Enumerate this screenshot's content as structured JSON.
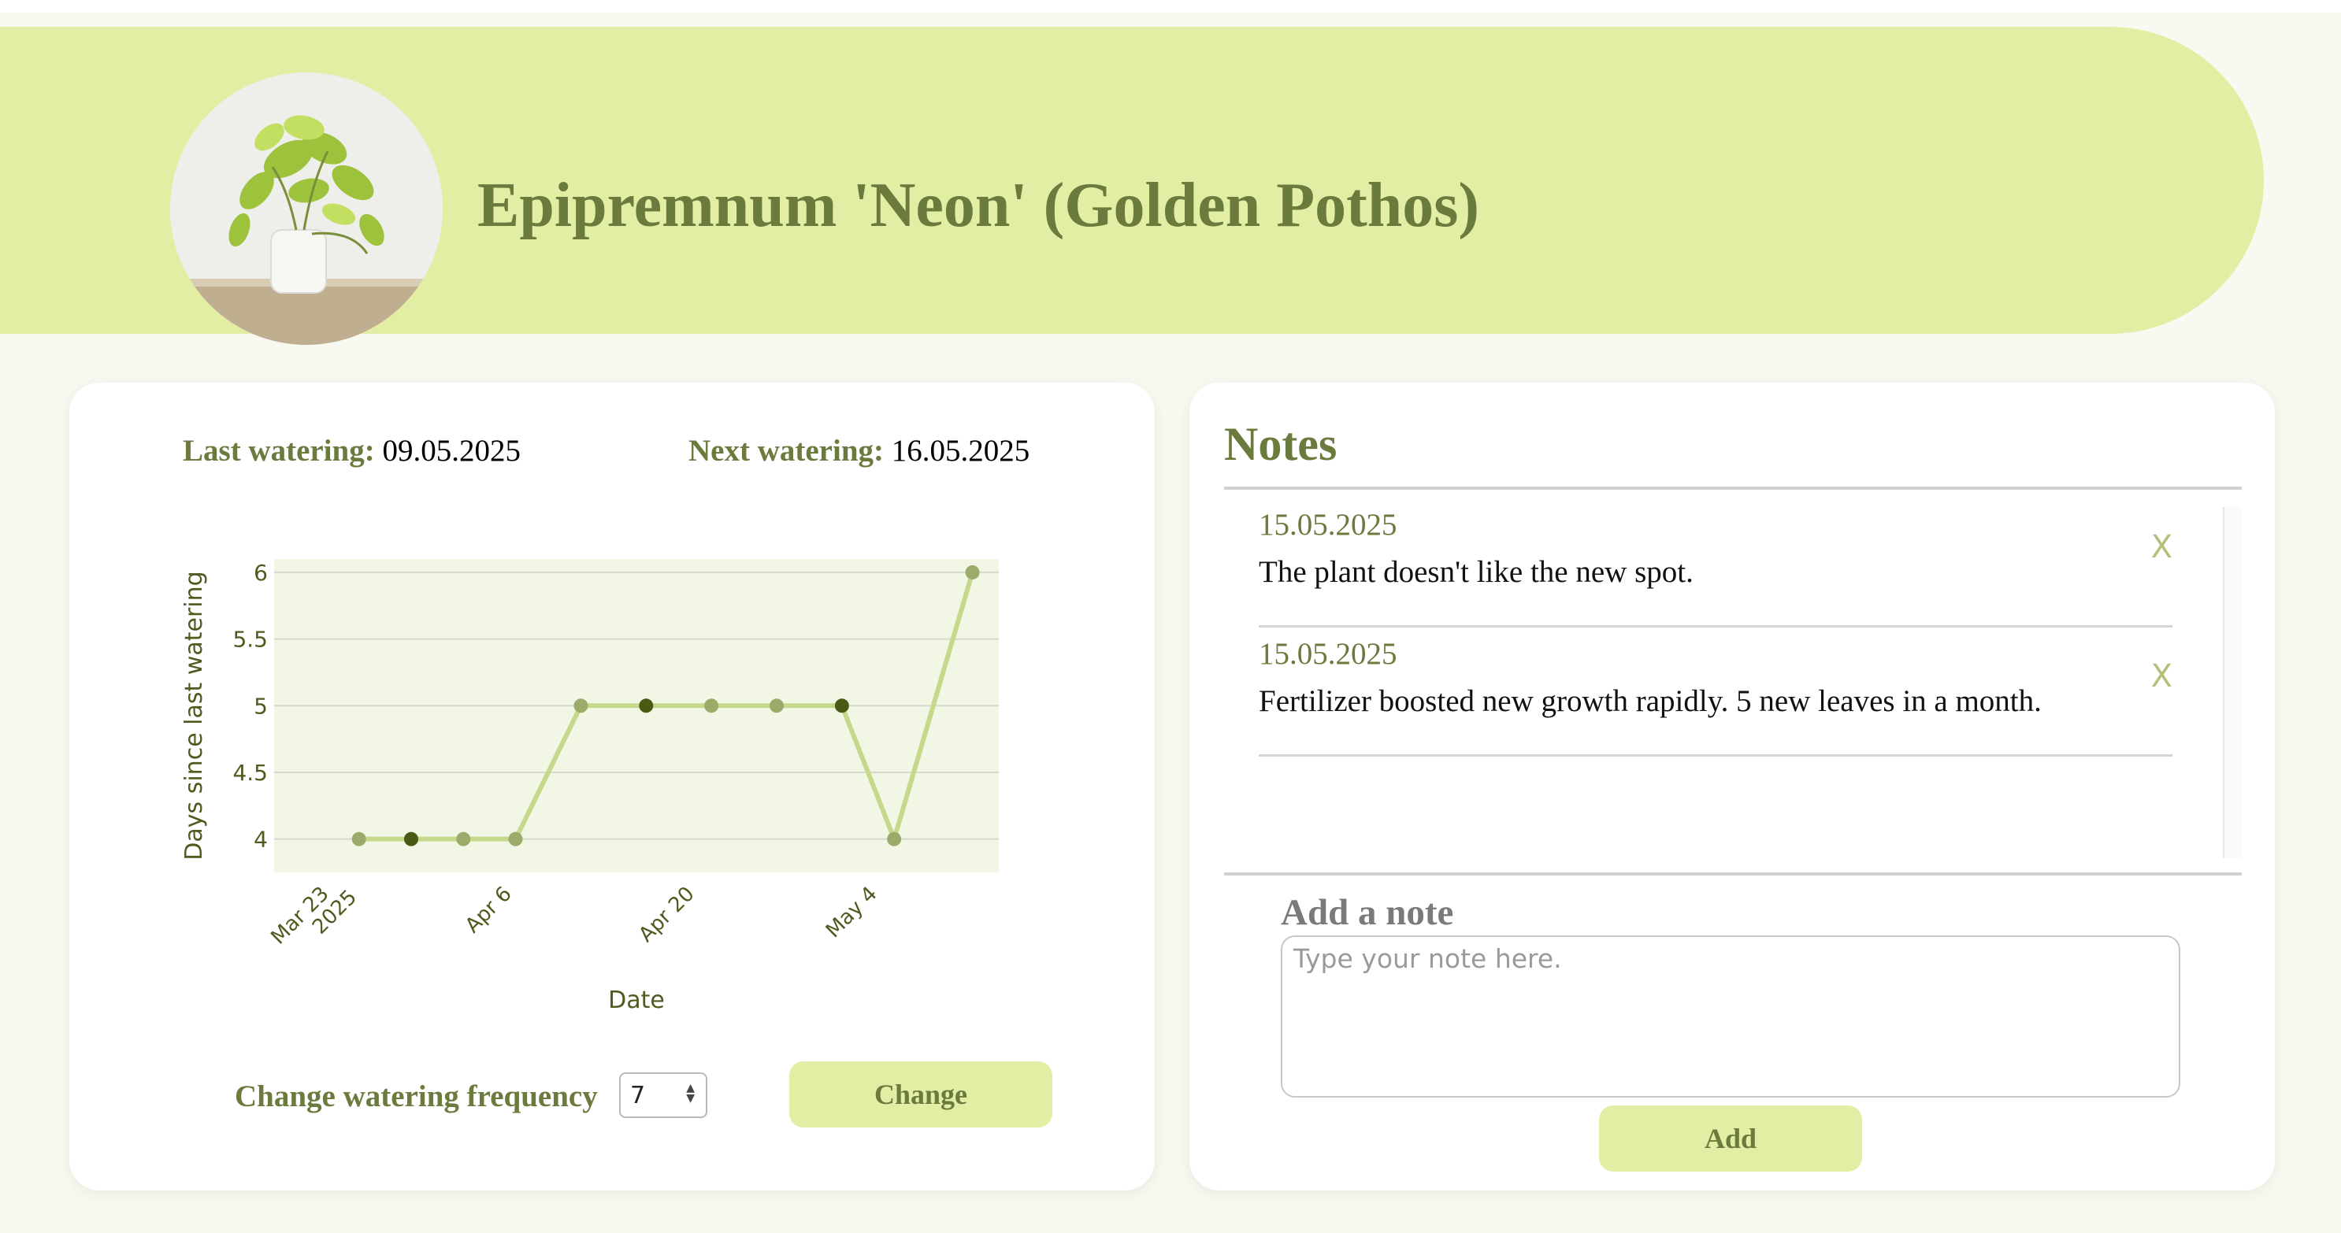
{
  "app": {
    "accent": "#e2eea3",
    "title_color": "#6b7a3d"
  },
  "plant": {
    "name": "Epipremnum 'Neon' (Golden Pothos)"
  },
  "watering": {
    "last_label": "Last watering:",
    "last_value": "09.05.2025",
    "next_label": "Next watering:",
    "next_value": "16.05.2025",
    "frequency_label": "Change watering frequency",
    "frequency_value": "7",
    "change_button": "Change"
  },
  "chart_data": {
    "type": "line",
    "xlabel": "Date",
    "ylabel": "Days since last watering",
    "ylim": [
      3.75,
      6.1
    ],
    "yticks": [
      "4",
      "4.5",
      "5",
      "5.5",
      "6"
    ],
    "xticks": [
      {
        "label": "Mar 23",
        "sublabel": "2025",
        "date": "2025-03-23"
      },
      {
        "label": "Apr 6",
        "sublabel": "",
        "date": "2025-04-06"
      },
      {
        "label": "Apr 20",
        "sublabel": "",
        "date": "2025-04-20"
      },
      {
        "label": "May 4",
        "sublabel": "",
        "date": "2025-05-04"
      }
    ],
    "points": [
      {
        "x": "2025-03-26",
        "y": 4,
        "dark": false
      },
      {
        "x": "2025-03-30",
        "y": 4,
        "dark": true
      },
      {
        "x": "2025-04-03",
        "y": 4,
        "dark": false
      },
      {
        "x": "2025-04-07",
        "y": 4,
        "dark": false
      },
      {
        "x": "2025-04-12",
        "y": 5,
        "dark": false
      },
      {
        "x": "2025-04-17",
        "y": 5,
        "dark": true
      },
      {
        "x": "2025-04-22",
        "y": 5,
        "dark": false
      },
      {
        "x": "2025-04-27",
        "y": 5,
        "dark": false
      },
      {
        "x": "2025-05-02",
        "y": 5,
        "dark": true
      },
      {
        "x": "2025-05-06",
        "y": 4,
        "dark": false
      },
      {
        "x": "2025-05-12",
        "y": 6,
        "dark": false
      }
    ],
    "colors": {
      "line": "#c5d98d",
      "point": "#9bab6a",
      "point_dark": "#4a5a14",
      "plot_bg": "#f2f6e4",
      "grid": "#d6d9cc"
    },
    "grid": true,
    "legend": "none"
  },
  "notes": {
    "title": "Notes",
    "items": [
      {
        "date": "15.05.2025",
        "text": "The plant doesn't like the new spot.",
        "delete": "X"
      },
      {
        "date": "15.05.2025",
        "text": "Fertilizer boosted new growth rapidly. 5 new leaves in a month.",
        "delete": "X"
      }
    ],
    "add_label": "Add a note",
    "placeholder": "Type your note here.",
    "add_button": "Add"
  }
}
